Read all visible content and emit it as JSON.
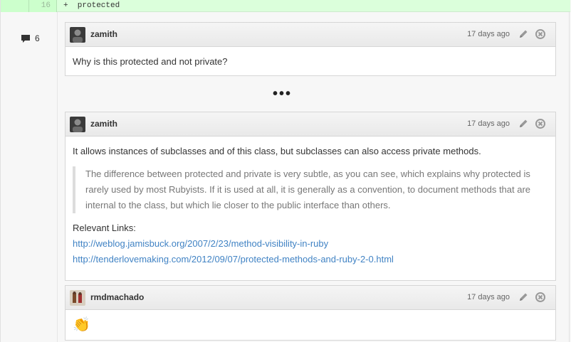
{
  "diff": {
    "line_number": "16",
    "code": "+  protected"
  },
  "gutter": {
    "comment_count": "6"
  },
  "comments": [
    {
      "author": "zamith",
      "time": "17 days ago",
      "body": "Why is this protected and not private?"
    },
    {
      "author": "zamith",
      "time": "17 days ago",
      "body": "It allows instances of subclasses and of this class, but subclasses can also access private methods.",
      "quote": "The difference between protected and private is very subtle, as you can see, which explains why protected is rarely used by most Rubyists. If it is used at all, it is generally as a convention, to document methods that are internal to the class, but which lie closer to the public interface than others.",
      "links_label": "Relevant Links:",
      "links": [
        "http://weblog.jamisbuck.org/2007/2/23/method-visibility-in-ruby",
        "http://tenderlovemaking.com/2012/09/07/protected-methods-and-ruby-2-0.html"
      ]
    },
    {
      "author": "rmdmachado",
      "time": "17 days ago",
      "body": "👏"
    }
  ],
  "ellipsis": "•••",
  "colors": {
    "link": "#4183c4",
    "added_line": "#dbffdb"
  }
}
